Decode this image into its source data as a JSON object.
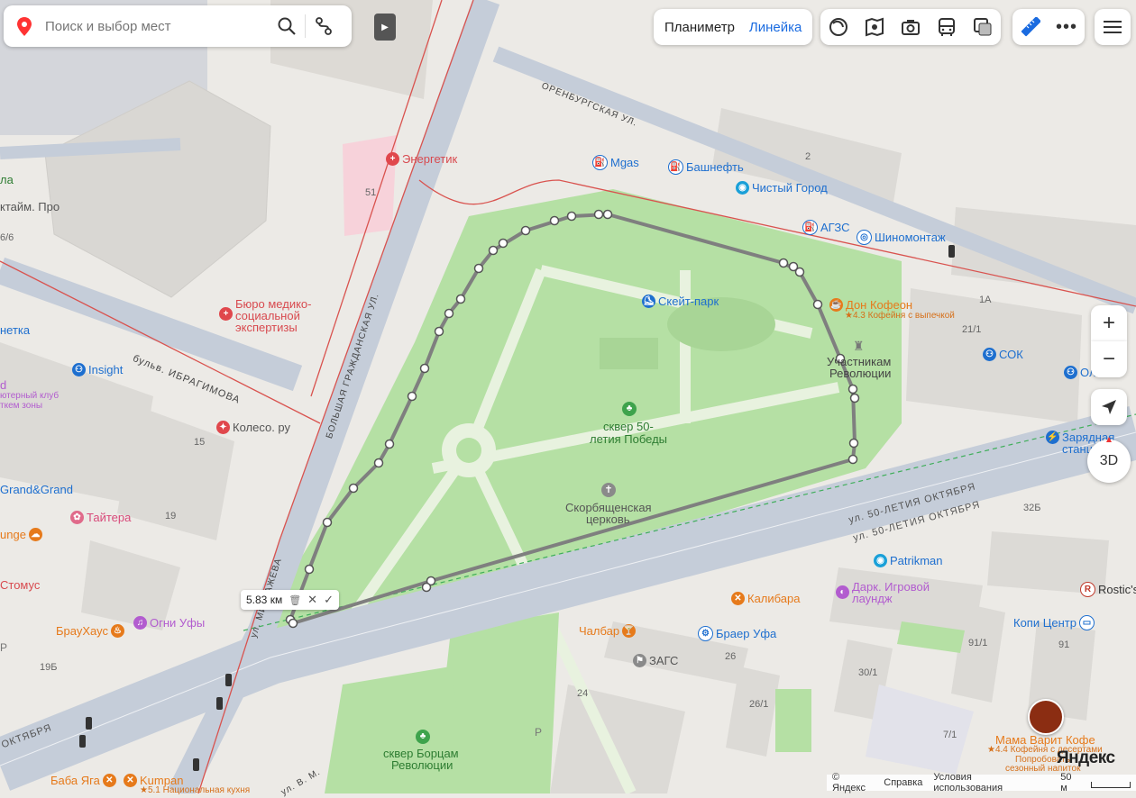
{
  "search": {
    "placeholder": "Поиск и выбор мест"
  },
  "toolbar": {
    "planimeter_label": "Планиметр",
    "ruler_label": "Линейка",
    "layer_icons": [
      "panorama-icon",
      "photo-map-icon",
      "camera-icon",
      "transport-icon",
      "layers-icon"
    ],
    "tools_icons": [
      "ruler-icon",
      "more-icon"
    ]
  },
  "controls": {
    "zoom_in": "+",
    "zoom_out": "−",
    "mode_3d": "3D"
  },
  "ruler": {
    "distance": "5.83 км"
  },
  "footer": {
    "copyright": "© Яндекс",
    "help": "Справка",
    "terms": "Условия использования",
    "scale": "50 м",
    "logo": "Яндекс"
  },
  "streets": {
    "orenburgskaya": "ОРЕНБУРГСКАЯ УЛ.",
    "grazhdanskaya": "БОЛЬШАЯ ГРАЖДАНСКАЯ УЛ.",
    "ibragimova": "бульв. ИБРАГИМОВА",
    "oktyabrya_1": "ул. 50-ЛЕТИЯ ОКТЯБРЯ",
    "oktyabrya_2": "ул. 50-ЛЕТИЯ ОКТЯБРЯ",
    "oktyabrya_left": "ОКТЯБРЯ",
    "mingazheva": "ул. МИНГАЖЕВА",
    "v_m": "ул. В. М."
  },
  "places": {
    "energetik": "Энергетик",
    "mgas": "Mgas",
    "bashneft": "Башнефть",
    "chisty_gorod": "Чистый Город",
    "agzs": "АГЗС",
    "shinomontazh": "Шиномонтаж",
    "skatepark": "Скейт-парк",
    "don_kofeon": "Дон Кофеон",
    "don_kofeon_sub": "★4.3 Кофейня с выпечкой",
    "soc": "СОК",
    "olimp": "Оли...",
    "uchastnikam_1": "Участникам",
    "uchastnikam_2": "Революции",
    "zaryadnaya_1": "Зарядная",
    "zaryadnaya_2": "станц...",
    "skver_pobedy_1": "сквер 50-",
    "skver_pobedy_2": "летия Победы",
    "skorbyashchenskaya_1": "Скорбященская",
    "skorbyashchenskaya_2": "церковь",
    "byuro_1": "Бюро медико-",
    "byuro_2": "социальной",
    "byuro_3": "экспертизы",
    "insight": "Insight",
    "koleso": "Колесо. ру",
    "grand": "Grand&Grand",
    "taitera": "Тайтера",
    "lounge": "unge",
    "stomus": "Стомус",
    "brauhaus": "БрауХаус",
    "ogni_ufy": "Огни Уфы",
    "patrikman": "Patrikman",
    "kalibara": "Калибара",
    "dark_1": "Дарк. Игровой",
    "dark_2": "лаундж",
    "rostics": "Rostic's",
    "chalbar": "Чалбар",
    "braer": "Браер Уфа",
    "zags": "ЗАГС",
    "kopi": "Копи Центр",
    "mama_1": "Мама Варит Кофе",
    "mama_2": "★4.4 Кофейня с десертами",
    "mama_3": "Попробовать",
    "mama_4": "сезонный напиток",
    "skver_borcov_1": "сквер Борцам",
    "skver_borcov_2": "Революции",
    "baba_yaga": "Баба Яга",
    "kumpan": "Kumpan",
    "kumpan_sub": "★5.1 Национальная кухня",
    "kaitim": "ктайм. Про",
    "netka": "нетка",
    "club_1": "d",
    "club_2": "ютерный клуб",
    "club_3": "ткем зоны",
    "la": "ла",
    "p_left": "P",
    "p_bottom": "P"
  },
  "house_numbers": {
    "h2": "2",
    "h51": "51",
    "h1a": "1А",
    "h21_1": "21/1",
    "h15": "15",
    "h19": "19",
    "h32b": "32Б",
    "h91_1": "91/1",
    "h91": "91",
    "h30_1": "30/1",
    "h26": "26",
    "h26_1": "26/1",
    "h24": "24",
    "h7_1": "7/1",
    "h19b": "19Б",
    "h6_6": "6/6"
  },
  "colors": {
    "park": "#b5e0a4",
    "road": "#c5cdd9",
    "building": "#dcdad6",
    "accent_blue": "#1a6be0",
    "poi_blue": "#1e6fcf",
    "poi_orange": "#e67a1b",
    "poi_red": "#e0474c",
    "poi_purple": "#b25ccf"
  }
}
